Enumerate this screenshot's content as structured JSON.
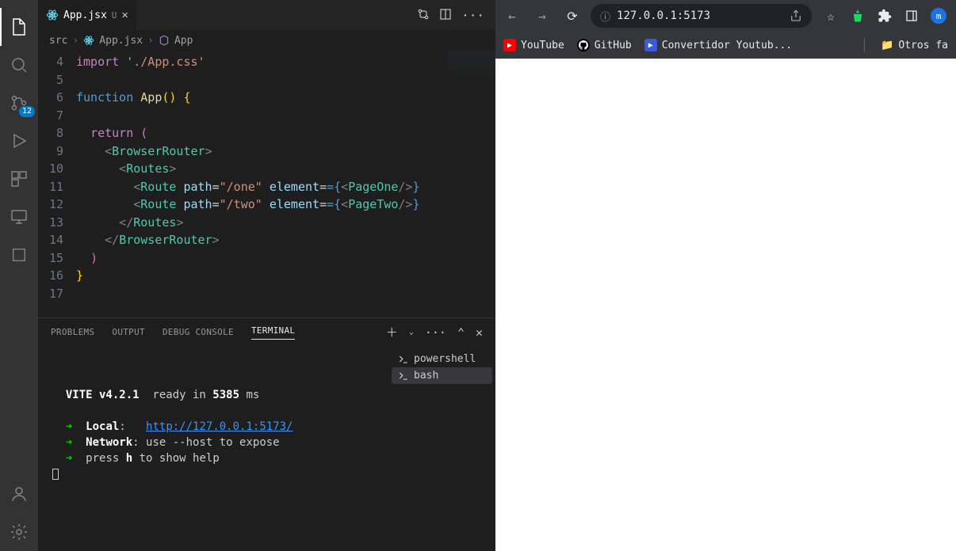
{
  "activityBar": {
    "sourceControlBadge": "12"
  },
  "tab": {
    "filename": "App.jsx",
    "dirtyMark": "U"
  },
  "breadcrumb": {
    "folder": "src",
    "file": "App.jsx",
    "symbol": "App"
  },
  "code": {
    "lineNumbers": [
      "4",
      "5",
      "6",
      "7",
      "8",
      "9",
      "10",
      "11",
      "12",
      "13",
      "14",
      "15",
      "16",
      "17"
    ],
    "line4": {
      "import": "import",
      "path": "'./App.css'"
    },
    "line6": {
      "function": "function",
      "name": "App",
      "rest": "() {"
    },
    "line8": {
      "return": "return",
      "paren": " ("
    },
    "line9": {
      "open": "<",
      "tag": "BrowserRouter",
      "close": ">"
    },
    "line10": {
      "open": "<",
      "tag": "Routes",
      "close": ">"
    },
    "line11": {
      "open": "<",
      "tag": "Route",
      "attr1": "path",
      "eq": "=",
      "val1": "\"/one\"",
      "attr2": "element",
      "val2open": "={",
      "comp": "PageOne",
      "val2close": "/>"
    },
    "line12": {
      "open": "<",
      "tag": "Route",
      "attr1": "path",
      "eq": "=",
      "val1": "\"/two\"",
      "attr2": "element",
      "val2open": "={",
      "comp": "PageTwo",
      "val2close": "/>"
    },
    "line13": {
      "open": "</",
      "tag": "Routes",
      "close": ">"
    },
    "line14": {
      "open": "</",
      "tag": "BrowserRouter",
      "close": ">"
    },
    "line15": {
      "paren": ")"
    },
    "line16": {
      "brace": "}"
    }
  },
  "panel": {
    "tabs": {
      "problems": "PROBLEMS",
      "output": "OUTPUT",
      "debug": "DEBUG CONSOLE",
      "terminal": "TERMINAL"
    },
    "terminalList": {
      "powershell": "powershell",
      "bash": "bash"
    }
  },
  "terminal": {
    "vite": "VITE v4.2.1",
    "ready": "  ready in ",
    "ms": "5385",
    "msLabel": " ms",
    "arrow": "➜",
    "localLabel": "Local",
    "localUrl": "http://127.0.0.1:5173/",
    "networkLabel": "Network",
    "networkHint": ": use --host to expose",
    "pressLabel": "press ",
    "h": "h",
    "helpLabel": " to show help"
  },
  "browser": {
    "url": "127.0.0.1:5173",
    "bookmarks": {
      "youtube": "YouTube",
      "github": "GitHub",
      "convertidor": "Convertidor Youtub...",
      "otros": "Otros fa"
    }
  }
}
